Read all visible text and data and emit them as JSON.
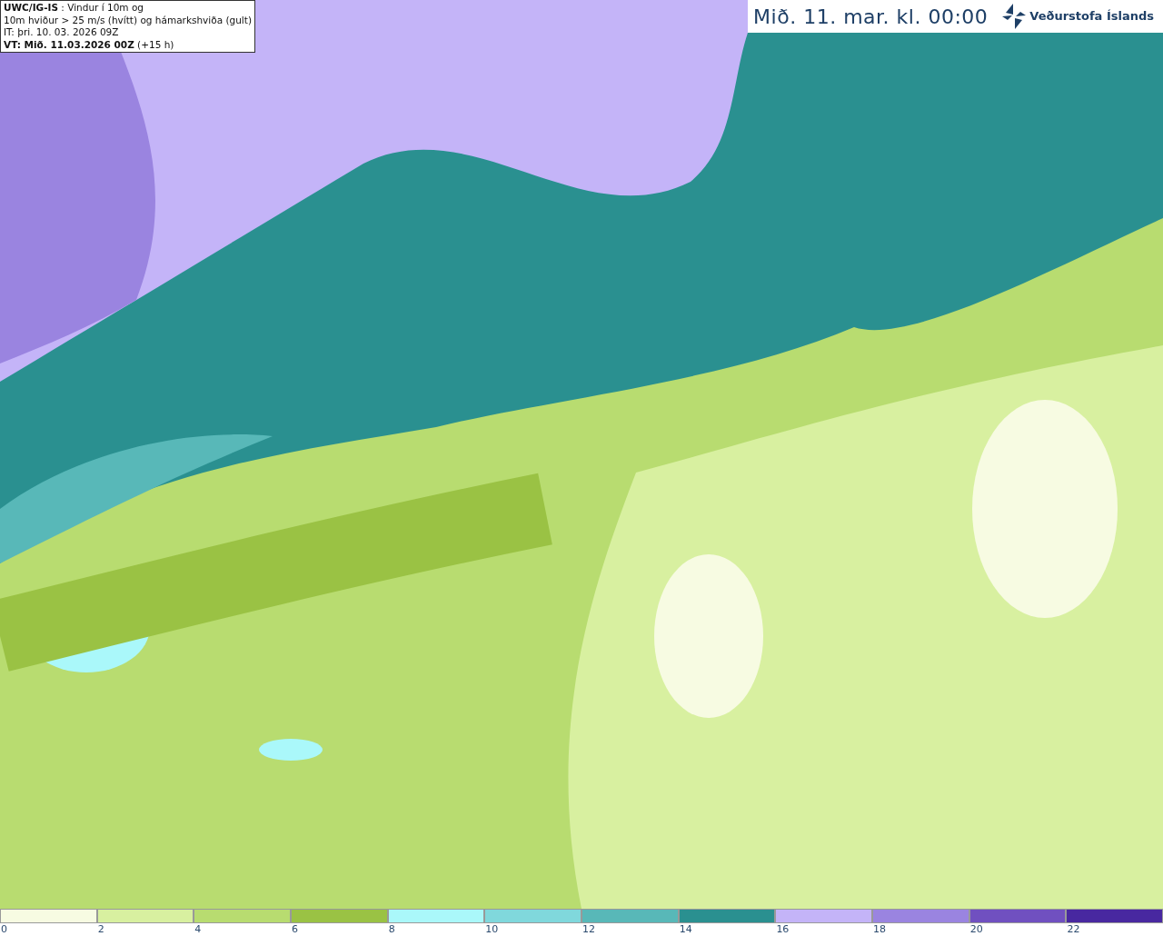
{
  "info_box": {
    "lines": [
      "**UWC/IG-IS** : Vindur í 10m og",
      "10m hviður > 25 m/s (hvítt) og hámarkshviða (gult)",
      "IT: þri. 10. 03. 2026 09Z",
      "**VT: Mið. 11.03.2026 00Z** (+15 h)"
    ]
  },
  "header": {
    "time": "Mið. 11. mar. kl. 00:00",
    "logo_text": "Veðurstofa Íslands"
  },
  "color_scale": [
    {
      "label": "0",
      "color": "#f7fbe2"
    },
    {
      "label": "2",
      "color": "#d8f0a0"
    },
    {
      "label": "4",
      "color": "#b8dc70"
    },
    {
      "label": "6",
      "color": "#9ac244"
    },
    {
      "label": "8",
      "color": "#aaf8fa"
    },
    {
      "label": "10",
      "color": "#80d8dc"
    },
    {
      "label": "12",
      "color": "#58b8b8"
    },
    {
      "label": "14",
      "color": "#2a9090"
    },
    {
      "label": "16",
      "color": "#c4b4f8"
    },
    {
      "label": "18",
      "color": "#9a84e0"
    },
    {
      "label": "20",
      "color": "#7050c0"
    },
    {
      "label": "22",
      "color": "#4828a0"
    }
  ]
}
